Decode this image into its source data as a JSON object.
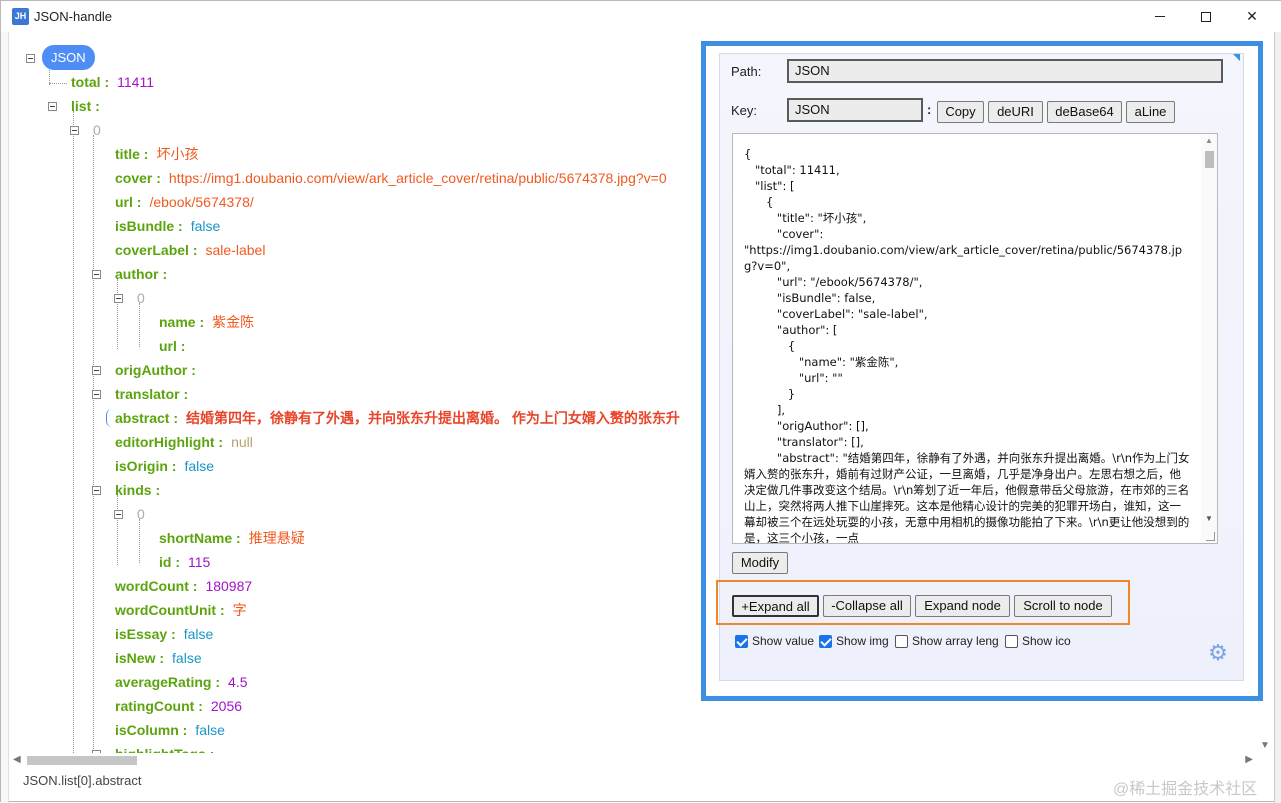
{
  "window": {
    "app_icon_text": "JH",
    "title": "JSON-handle"
  },
  "tree": {
    "root_label": "JSON",
    "rows": [
      {
        "key": "total",
        "value": "11411",
        "type": "num"
      },
      {
        "key": "list",
        "value": "",
        "type": "obj"
      },
      {
        "index": "0"
      },
      {
        "key": "title",
        "value": "坏小孩",
        "type": "str"
      },
      {
        "key": "cover",
        "value": "https://img1.doubanio.com/view/ark_article_cover/retina/public/5674378.jpg?v=0",
        "type": "str"
      },
      {
        "key": "url",
        "value": "/ebook/5674378/",
        "type": "str"
      },
      {
        "key": "isBundle",
        "value": "false",
        "type": "bool"
      },
      {
        "key": "coverLabel",
        "value": "sale-label",
        "type": "str"
      },
      {
        "key": "author",
        "value": "",
        "type": "obj"
      },
      {
        "index": "0"
      },
      {
        "key": "name",
        "value": "紫金陈",
        "type": "str"
      },
      {
        "key": "url",
        "value": "",
        "type": "str"
      },
      {
        "key": "origAuthor",
        "value": "",
        "type": "obj"
      },
      {
        "key": "translator",
        "value": "",
        "type": "obj"
      },
      {
        "key": "abstract",
        "value": "结婚第四年，徐静有了外遇，并向张东升提出离婚。 作为上门女婿入赘的张东升",
        "type": "text"
      },
      {
        "key": "editorHighlight",
        "value": "null",
        "type": "null"
      },
      {
        "key": "isOrigin",
        "value": "false",
        "type": "bool"
      },
      {
        "key": "kinds",
        "value": "",
        "type": "obj"
      },
      {
        "index": "0"
      },
      {
        "key": "shortName",
        "value": "推理悬疑",
        "type": "str"
      },
      {
        "key": "id",
        "value": "115",
        "type": "num"
      },
      {
        "key": "wordCount",
        "value": "180987",
        "type": "num"
      },
      {
        "key": "wordCountUnit",
        "value": "字",
        "type": "str"
      },
      {
        "key": "isEssay",
        "value": "false",
        "type": "bool"
      },
      {
        "key": "isNew",
        "value": "false",
        "type": "bool"
      },
      {
        "key": "averageRating",
        "value": "4.5",
        "type": "num"
      },
      {
        "key": "ratingCount",
        "value": "2056",
        "type": "num"
      },
      {
        "key": "isColumn",
        "value": "false",
        "type": "bool"
      },
      {
        "key": "highlightTags",
        "value": "",
        "type": "obj"
      }
    ]
  },
  "panel": {
    "path_label": "Path:",
    "path_value": "JSON",
    "key_label": "Key:",
    "key_value": "JSON",
    "key_sep": ":",
    "buttons": {
      "copy": "Copy",
      "deuri": "deURI",
      "debase64": "deBase64",
      "aline": "aLine",
      "modify": "Modify",
      "expand_all": "+Expand all",
      "collapse_all": "-Collapse all",
      "expand_node": "Expand node",
      "scroll_to_node": "Scroll to node"
    },
    "json_text": "{\n   \"total\": 11411,\n   \"list\": [\n      {\n         \"title\": \"坏小孩\",\n         \"cover\":\n\"https://img1.doubanio.com/view/ark_article_cover/retina/public/5674378.jpg?v=0\",\n         \"url\": \"/ebook/5674378/\",\n         \"isBundle\": false,\n         \"coverLabel\": \"sale-label\",\n         \"author\": [\n            {\n               \"name\": \"紫金陈\",\n               \"url\": \"\"\n            }\n         ],\n         \"origAuthor\": [],\n         \"translator\": [],\n         \"abstract\": \"结婚第四年，徐静有了外遇，并向张东升提出离婚。\\r\\n作为上门女婿入赘的张东升，婚前有过财产公证，一旦离婚，几乎是净身出户。左思右想之后，他决定做几件事改变这个结局。\\r\\n筹划了近一年后，他假意带岳父母旅游，在市郊的三名山上，突然将两人推下山崖摔死。这本是他精心设计的完美的犯罪开场白，谁知，这一幕却被三个在远处玩耍的小孩，无意中用相机的摄像功能拍了下来。\\r\\n更让他没想到的是，这三个小孩，一点",
    "checkboxes": [
      {
        "label": "Show value",
        "checked": true
      },
      {
        "label": "Show img",
        "checked": true
      },
      {
        "label": "Show array leng",
        "checked": false
      },
      {
        "label": "Show ico",
        "checked": false
      }
    ]
  },
  "status": {
    "path": "JSON.list[0].abstract"
  },
  "watermark": "@稀土掘金技术社区",
  "colors": {
    "key": "#5ca40e",
    "number": "#a214c9",
    "string": "#f05a22",
    "bool": "#1a96c8",
    "highlight_border": "#3d8fe3",
    "orange_border": "#f0872c"
  }
}
